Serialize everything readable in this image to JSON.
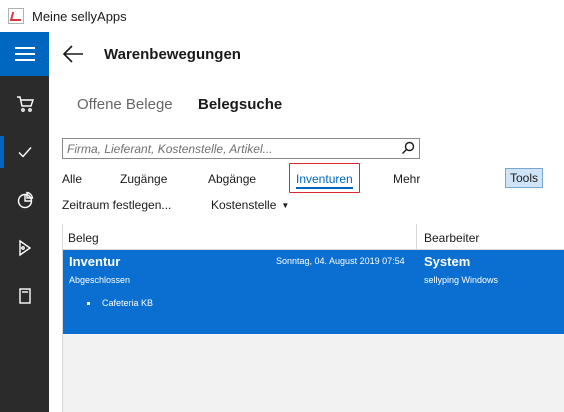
{
  "window": {
    "title": "Meine sellyApps"
  },
  "rail": {
    "items": [
      {
        "icon": "hamburger-icon"
      },
      {
        "icon": "cart-icon"
      },
      {
        "icon": "checkmark-icon"
      },
      {
        "icon": "pie-chart-icon"
      },
      {
        "icon": "tag-icon"
      },
      {
        "icon": "book-icon"
      }
    ],
    "accent": "#0067c0",
    "background": "#2b2b2b"
  },
  "header": {
    "title": "Warenbewegungen"
  },
  "tabs": [
    {
      "label": "Offene Belege",
      "active": false
    },
    {
      "label": "Belegsuche",
      "active": true
    }
  ],
  "search": {
    "placeholder": "Firma, Lieferant, Kostenstelle, Artikel...",
    "value": ""
  },
  "filters": {
    "items": [
      {
        "label": "Alle"
      },
      {
        "label": "Zugänge"
      },
      {
        "label": "Abgänge"
      },
      {
        "label": "Inventuren",
        "selected": true
      },
      {
        "label": "Mehr"
      }
    ],
    "tools_label": "Tools",
    "zeitraum_label": "Zeitraum festlegen...",
    "kostenstelle_label": "Kostenstelle"
  },
  "list": {
    "columns": [
      "Beleg",
      "Bearbeiter"
    ],
    "rows": [
      {
        "title": "Inventur",
        "date": "Sonntag, 04. August 2019 07:54",
        "status": "Abgeschlossen",
        "bullets": [
          "Cafeteria KB"
        ],
        "user": "System",
        "user_detail": "sellyping Windows",
        "selected": true
      }
    ],
    "selected_color": "#0a6fd1"
  }
}
